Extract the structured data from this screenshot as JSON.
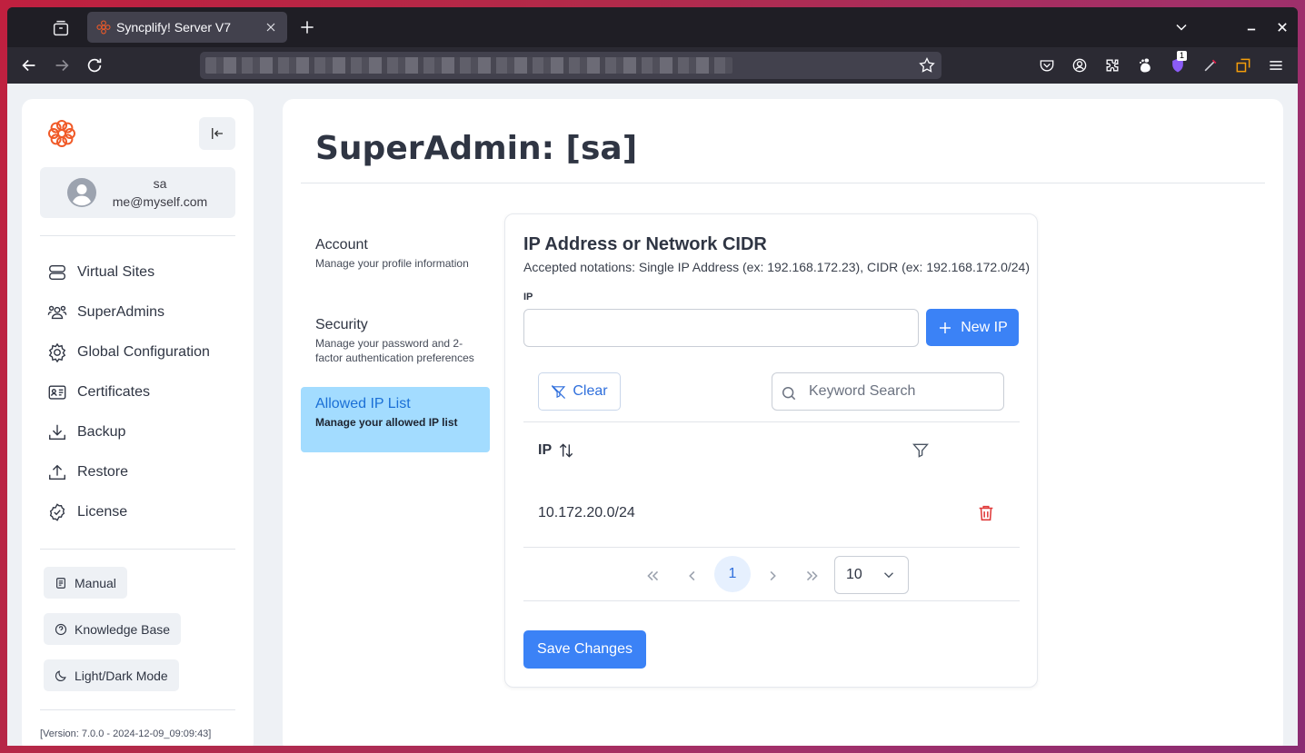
{
  "browser": {
    "tab_title": "Syncplify! Server V7",
    "notification_badge": "1"
  },
  "sidebar": {
    "user_name": "sa",
    "user_email": "me@myself.com",
    "items": [
      {
        "label": "Virtual Sites",
        "icon": "server-icon"
      },
      {
        "label": "SuperAdmins",
        "icon": "users-icon"
      },
      {
        "label": "Global Configuration",
        "icon": "cog-icon"
      },
      {
        "label": "Certificates",
        "icon": "id-card-icon"
      },
      {
        "label": "Backup",
        "icon": "download-icon"
      },
      {
        "label": "Restore",
        "icon": "upload-icon"
      },
      {
        "label": "License",
        "icon": "check-circle-icon"
      }
    ],
    "links": {
      "manual": "Manual",
      "knowledge_base": "Knowledge Base",
      "theme": "Light/Dark Mode"
    },
    "version": "[Version: 7.0.0 - 2024-12-09_09:09:43]"
  },
  "main": {
    "page_title": "SuperAdmin: [sa]",
    "menu": [
      {
        "title": "Account",
        "subtitle": "Manage your profile information"
      },
      {
        "title": "Security",
        "subtitle": "Manage your password and 2-factor authentication preferences"
      },
      {
        "title": "Allowed IP List",
        "subtitle": "Manage your allowed IP list"
      }
    ],
    "card": {
      "title": "IP Address or Network CIDR",
      "subtitle": "Accepted notations: Single IP Address (ex: 192.168.172.23), CIDR (ex: 192.168.172.0/24)",
      "ip_label": "IP",
      "ip_value": "",
      "new_ip_label": "New IP",
      "clear_label": "Clear",
      "search_placeholder": "Keyword Search",
      "table": {
        "column": "IP",
        "rows": [
          "10.172.20.0/24"
        ]
      },
      "pagination": {
        "current_page": "1",
        "page_size": "10"
      },
      "save_label": "Save Changes"
    }
  },
  "colors": {
    "accent": "#3b82f6",
    "active_menu_bg": "#a3dcff",
    "danger": "#e03b3b",
    "brand_logo": "#f05a28"
  }
}
